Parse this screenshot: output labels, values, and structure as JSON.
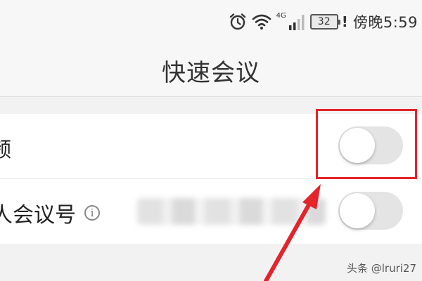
{
  "status_bar": {
    "network_type": "4G",
    "battery_level": "32",
    "battery_alert": "!",
    "time": "傍晚5:59",
    "icons": [
      "alarm-icon",
      "wifi-icon",
      "signal-icon",
      "battery-icon"
    ]
  },
  "header": {
    "title": "快速会议"
  },
  "settings": [
    {
      "label": "频",
      "toggle_on": false
    },
    {
      "label": "人会议号",
      "toggle_on": false,
      "info_icon": "info-icon"
    }
  ],
  "annotation": {
    "box_color": "#e3242b",
    "arrow_color": "#e3242b"
  },
  "watermark": {
    "text": "头条 @lruri27"
  }
}
